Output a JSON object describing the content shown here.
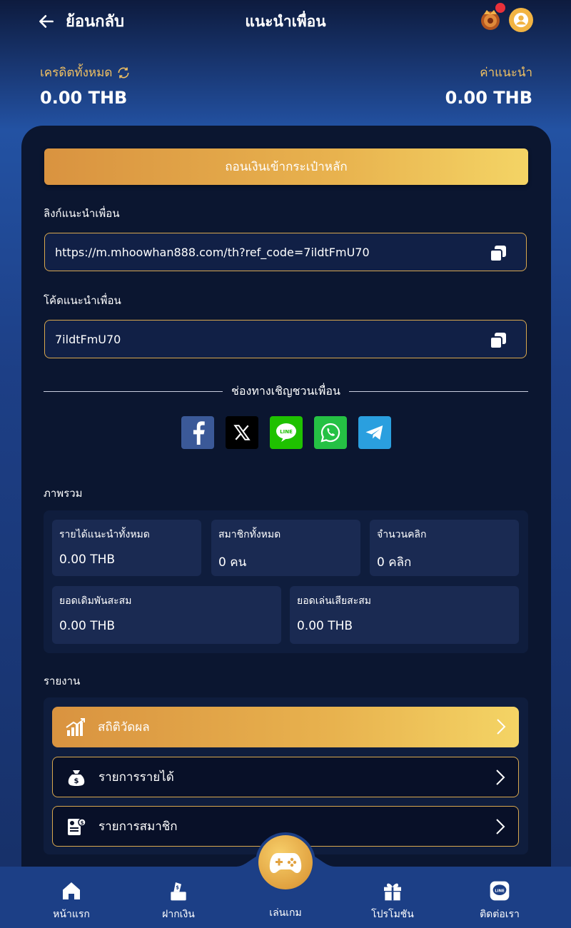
{
  "header": {
    "back_label": "ย้อนกลับ",
    "title": "แนะนำเพื่อน"
  },
  "balances": {
    "credit_label": "เครดิตทั้งหมด",
    "credit_value": "0.00 THB",
    "referral_label": "ค่าแนะนำ",
    "referral_value": "0.00 THB"
  },
  "withdraw_button": "ถอนเงินเข้ากระเป๋าหลัก",
  "ref_link": {
    "label": "ลิงก์แนะนำเพื่อน",
    "value": "https://m.mhoowhan888.com/th?ref_code=7ildtFmU70"
  },
  "ref_code": {
    "label": "โค้ดแนะนำเพื่อน",
    "value": "7ildtFmU70"
  },
  "invite_channels": "ช่องทางเชิญชวนเพื่อน",
  "socials": [
    "facebook-icon",
    "x-icon",
    "line-icon",
    "whatsapp-icon",
    "telegram-icon"
  ],
  "overview": {
    "title": "ภาพรวม",
    "stats": [
      {
        "label": "รายได้แนะนำทั้งหมด",
        "value": "0.00 THB"
      },
      {
        "label": "สมาชิกทั้งหมด",
        "value": "0 คน"
      },
      {
        "label": "จำนวนคลิก",
        "value": "0 คลิก"
      },
      {
        "label": "ยอดเดิมพันสะสม",
        "value": "0.00 THB"
      },
      {
        "label": "ยอดเล่นเสียสะสม",
        "value": "0.00 THB"
      }
    ]
  },
  "reports": {
    "title": "รายงาน",
    "items": [
      {
        "label": "สถิติวัดผล",
        "icon": "chart-icon"
      },
      {
        "label": "รายการรายได้",
        "icon": "money-bag-icon"
      },
      {
        "label": "รายการสมาชิก",
        "icon": "member-list-icon"
      }
    ]
  },
  "nav": {
    "home": "หน้าแรก",
    "deposit": "ฝากเงิน",
    "play": "เล่นเกม",
    "promotion": "โปรโมชัน",
    "contact": "ติดต่อเรา"
  },
  "colors": {
    "accent": "#e8b24e",
    "card": "#0b1630",
    "badge": "#e8303a"
  }
}
